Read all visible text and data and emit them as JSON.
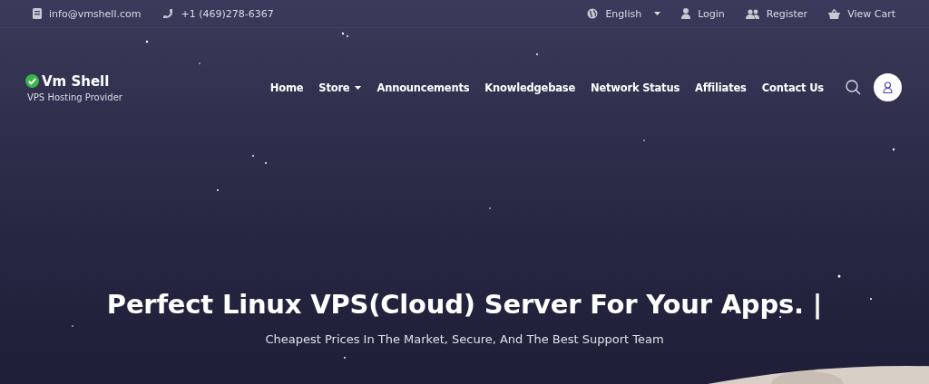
{
  "top_bar": {
    "contacts": [
      {
        "kind": "email",
        "text": "info@vmshell.com"
      },
      {
        "kind": "phone",
        "text": "+1 (469)278-6367"
      }
    ],
    "links": [
      {
        "kind": "language",
        "label": "English",
        "dropdown": true
      },
      {
        "kind": "login",
        "label": "Login",
        "dropdown": false
      },
      {
        "kind": "register",
        "label": "Register",
        "dropdown": false
      },
      {
        "kind": "cart",
        "label": "View Cart",
        "dropdown": false
      }
    ]
  },
  "header": {
    "logo": {
      "name": "Vm Shell",
      "tagline": "VPS Hosting Provider"
    },
    "nav": [
      {
        "label": "Home",
        "dropdown": false
      },
      {
        "label": "Store",
        "dropdown": true
      },
      {
        "label": "Announcements",
        "dropdown": false
      },
      {
        "label": "Knowledgebase",
        "dropdown": false
      },
      {
        "label": "Network Status",
        "dropdown": false
      },
      {
        "label": "Affiliates",
        "dropdown": false
      },
      {
        "label": "Contact Us",
        "dropdown": false
      }
    ]
  },
  "hero": {
    "title": "Perfect Linux VPS(Cloud) Server For Your Apps. |",
    "subtitle": "Cheapest Prices In The Market, Secure, And The Best Support Team"
  }
}
